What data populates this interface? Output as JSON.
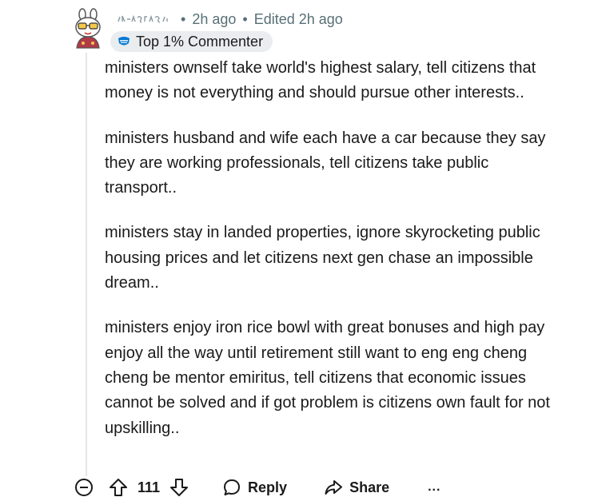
{
  "comment": {
    "username": "ukeiro2r",
    "separator1": "•",
    "time": "2h ago",
    "separator2": "•",
    "edited": "Edited 2h ago",
    "badge_label": "Top 1% Commenter",
    "paragraphs": [
      "ministers ownself take world's highest salary, tell citizens that money is not everything and should pursue other interests..",
      "ministers husband and wife each have a car because they say they are working professionals, tell citizens take public transport..",
      "ministers stay in landed properties, ignore skyrocketing public housing prices and let citizens next gen chase an impossible dream..",
      "ministers enjoy iron rice bowl with great bonuses and high pay enjoy all the way until retirement still want to eng eng cheng cheng be mentor emiritus, tell citizens that economic issues cannot be solved and if got problem is citizens own fault for not upskilling.."
    ]
  },
  "actions": {
    "vote_count": "111",
    "reply_label": "Reply",
    "share_label": "Share",
    "more_label": "..."
  },
  "icons": {
    "collapse": "collapse-minus-icon",
    "upvote": "upvote-arrow-icon",
    "downvote": "downvote-arrow-icon",
    "reply": "comment-bubble-icon",
    "share": "share-arrow-icon",
    "badge": "top-commenter-badge-icon"
  },
  "colors": {
    "meta_text": "#576f76",
    "badge_bg": "#eaedef",
    "body_text": "#1a1a1b",
    "thread_line": "#e3e6e8",
    "badge_icon": "#0079d3"
  }
}
